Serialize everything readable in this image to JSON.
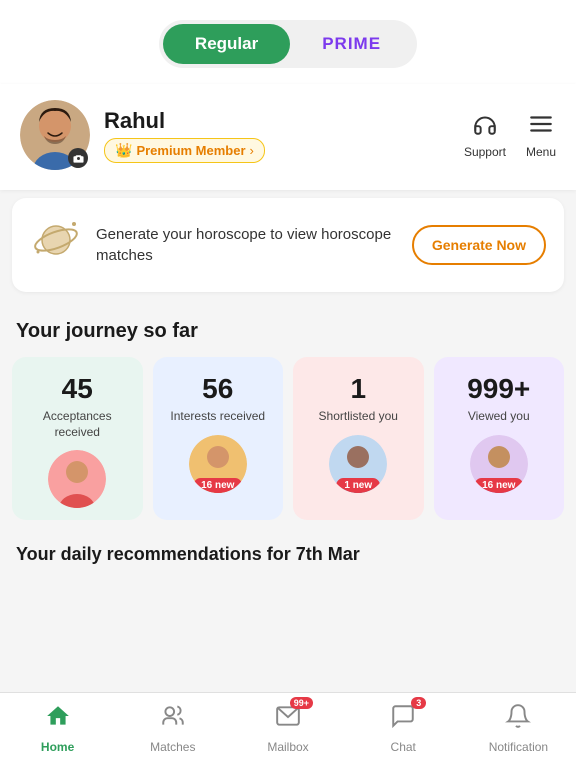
{
  "tabs": {
    "regular": "Regular",
    "prime": "PRIME"
  },
  "profile": {
    "name": "Rahul",
    "premium_label": "Premium Member",
    "support_label": "Support",
    "menu_label": "Menu"
  },
  "horoscope": {
    "text": "Generate your horoscope to view horoscope matches",
    "button_label": "Generate Now"
  },
  "journey": {
    "title": "Your journey so far",
    "stats": [
      {
        "number": "45",
        "label": "Acceptances received",
        "new_badge": null
      },
      {
        "number": "56",
        "label": "Interests received",
        "new_badge": "16 new"
      },
      {
        "number": "1",
        "label": "Shortlisted you",
        "new_badge": "1 new"
      },
      {
        "number": "999+",
        "label": "Viewed you",
        "new_badge": "16 new"
      }
    ]
  },
  "recommendations": {
    "title": "Your daily recommendations for 7th Mar"
  },
  "bottom_nav": {
    "items": [
      {
        "label": "Home",
        "active": true,
        "badge": null
      },
      {
        "label": "Matches",
        "active": false,
        "badge": null
      },
      {
        "label": "Mailbox",
        "active": false,
        "badge": "99+"
      },
      {
        "label": "Chat",
        "active": false,
        "badge": "3"
      },
      {
        "label": "Notification",
        "active": false,
        "badge": null
      }
    ]
  }
}
